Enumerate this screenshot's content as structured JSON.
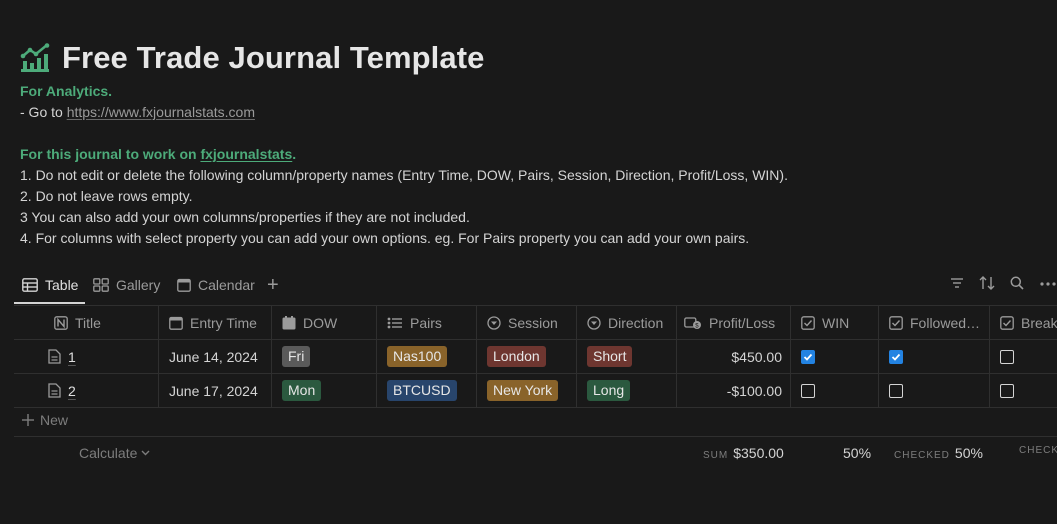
{
  "page": {
    "icon": "chart-growth-icon",
    "title": "Free Trade Journal Template",
    "analytics_heading": "For Analytics.",
    "goto_prefix": "- Go to ",
    "goto_link": "https://www.fxjournalstats.com",
    "work_prefix": "For this journal to work on ",
    "work_link": "fxjournalstats",
    "work_suffix": ".",
    "rules": [
      "1. Do not edit or delete the following column/property names  (Entry Time, DOW, Pairs, Session, Direction, Profit/Loss, WIN).",
      "2. Do not leave rows empty.",
      "3 You can also add your own columns/properties if they are not included.",
      "4. For columns with select property you can add your own options. eg. For Pairs property you can add your own pairs."
    ]
  },
  "views": {
    "tabs": [
      {
        "label": "Table",
        "icon": "table-icon",
        "active": true
      },
      {
        "label": "Gallery",
        "icon": "gallery-icon",
        "active": false
      },
      {
        "label": "Calendar",
        "icon": "calendar-icon",
        "active": false
      }
    ],
    "add_icon": "plus-icon",
    "tools": [
      "filter-icon",
      "sort-icon",
      "search-icon",
      "more-icon"
    ]
  },
  "table": {
    "columns": [
      {
        "label": "Title",
        "icon": "title-icon"
      },
      {
        "label": "Entry Time",
        "icon": "date-icon"
      },
      {
        "label": "DOW",
        "icon": "formula-icon"
      },
      {
        "label": "Pairs",
        "icon": "multi-select-icon"
      },
      {
        "label": "Session",
        "icon": "select-icon"
      },
      {
        "label": "Direction",
        "icon": "select-icon"
      },
      {
        "label": "Profit/Loss",
        "icon": "number-icon"
      },
      {
        "label": "WIN",
        "icon": "checkbox-icon"
      },
      {
        "label": "Followed…",
        "icon": "checkbox-icon"
      },
      {
        "label": "Break",
        "icon": "checkbox-icon"
      }
    ],
    "rows": [
      {
        "title": "1",
        "entry": "June 14, 2024",
        "dow": "Fri",
        "pair": "Nas100",
        "session": "London",
        "direction": "Short",
        "pl": "$450.00",
        "win": true,
        "followed": true,
        "break": false
      },
      {
        "title": "2",
        "entry": "June 17, 2024",
        "dow": "Mon",
        "pair": "BTCUSD",
        "session": "New York",
        "direction": "Long",
        "pl": "-$100.00",
        "win": false,
        "followed": false,
        "break": false
      }
    ],
    "tag_colors": {
      "Fri": "#5a5a5a",
      "Mon": "#2b593f",
      "Nas100": "#89632a",
      "BTCUSD": "#28456c",
      "London": "#6e3630",
      "New York": "#89632a",
      "Short": "#6e3630",
      "Long": "#2b593f"
    },
    "checkbox_color": "#2383e2",
    "new_label": "New",
    "calculate_label": "Calculate",
    "sum_label": "SUM",
    "sum_value": "$350.00",
    "win_pct": "50%",
    "checked_label": "CHECKED",
    "followed_pct": "50%",
    "break_label": "CHECK"
  }
}
